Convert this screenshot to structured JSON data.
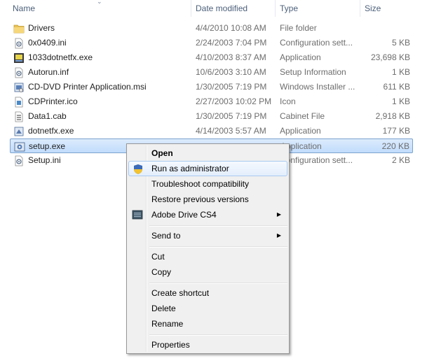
{
  "columns": {
    "name": "Name",
    "date": "Date modified",
    "type": "Type",
    "size": "Size"
  },
  "files": [
    {
      "name": "Drivers",
      "date": "4/4/2010 10:08 AM",
      "type": "File folder",
      "size": "",
      "icon": "folder-icon"
    },
    {
      "name": "0x0409.ini",
      "date": "2/24/2003 7:04 PM",
      "type": "Configuration sett...",
      "size": "5 KB",
      "icon": "ini-file-icon"
    },
    {
      "name": "1033dotnetfx.exe",
      "date": "4/10/2003 8:37 AM",
      "type": "Application",
      "size": "23,698 KB",
      "icon": "exe-icon"
    },
    {
      "name": "Autorun.inf",
      "date": "10/6/2003 3:10 AM",
      "type": "Setup Information",
      "size": "1 KB",
      "icon": "inf-file-icon"
    },
    {
      "name": "CD-DVD Printer Application.msi",
      "date": "1/30/2005 7:19 PM",
      "type": "Windows Installer ...",
      "size": "611 KB",
      "icon": "msi-file-icon"
    },
    {
      "name": "CDPrinter.ico",
      "date": "2/27/2003 10:02 PM",
      "type": "Icon",
      "size": "1 KB",
      "icon": "ico-file-icon"
    },
    {
      "name": "Data1.cab",
      "date": "1/30/2005 7:19 PM",
      "type": "Cabinet File",
      "size": "2,918 KB",
      "icon": "cab-file-icon"
    },
    {
      "name": "dotnetfx.exe",
      "date": "4/14/2003 5:57 AM",
      "type": "Application",
      "size": "177 KB",
      "icon": "exe-icon"
    },
    {
      "name": "setup.exe",
      "date": "",
      "type": "Application",
      "size": "220 KB",
      "icon": "setup-exe-icon",
      "selected": true
    },
    {
      "name": "Setup.ini",
      "date": "",
      "type": "Configuration sett...",
      "size": "2 KB",
      "icon": "ini-file-icon"
    }
  ],
  "context_menu": {
    "open": "Open",
    "run_as_admin": "Run as administrator",
    "troubleshoot": "Troubleshoot compatibility",
    "restore": "Restore previous versions",
    "adobe_drive": "Adobe Drive CS4",
    "send_to": "Send to",
    "cut": "Cut",
    "copy": "Copy",
    "create_shortcut": "Create shortcut",
    "delete": "Delete",
    "rename": "Rename",
    "properties": "Properties",
    "submenu_arrow": "▶"
  },
  "colors": {
    "selection": "#cce4fc",
    "menu_bg": "#f0f0f0",
    "header_text": "#4c607a"
  }
}
